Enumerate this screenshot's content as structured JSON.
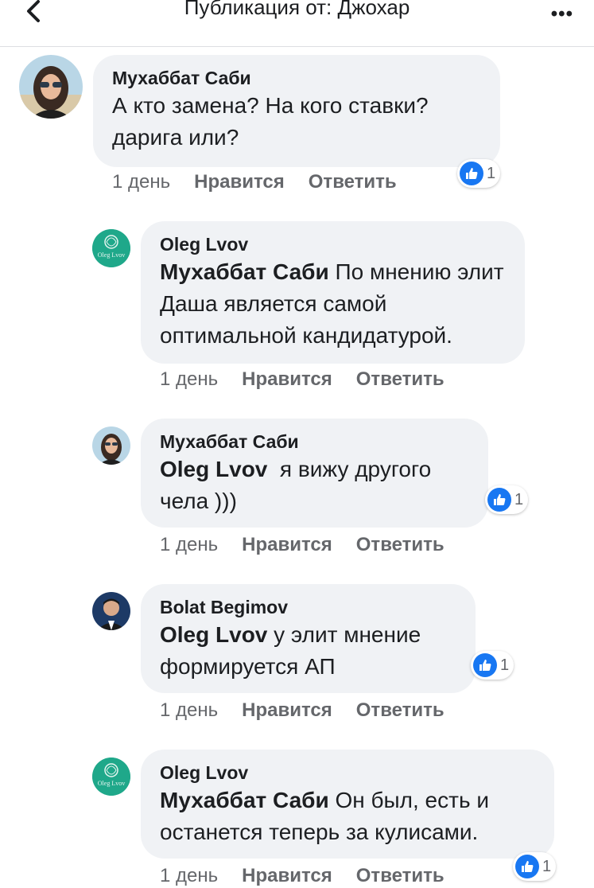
{
  "header": {
    "title": "Публикация от: Джохар",
    "more_label": "•••"
  },
  "comments": [
    {
      "author": "Мухаббат Саби",
      "mention": "",
      "text": "А кто замена? На кого ставки? дарига или?",
      "time": "1 день",
      "like_label": "Нравится",
      "reply_label": "Ответить",
      "reactions": "1"
    },
    {
      "author": "Oleg Lvov",
      "mention": "Мухаббат Саби",
      "text": "По мнению элит Даша является самой оптимальной кандидатурой.",
      "time": "1 день",
      "like_label": "Нравится",
      "reply_label": "Ответить",
      "avatar_text": "Oleg Lvov"
    },
    {
      "author": "Мухаббат Саби",
      "mention": "Oleg Lvov",
      "text": " я вижу другого чела )))",
      "time": "1 день",
      "like_label": "Нравится",
      "reply_label": "Ответить",
      "reactions": "1"
    },
    {
      "author": "Bolat Begimov",
      "mention": "Oleg Lvov",
      "text": "у элит мнение формируется АП",
      "time": "1 день",
      "like_label": "Нравится",
      "reply_label": "Ответить",
      "reactions": "1"
    },
    {
      "author": "Oleg Lvov",
      "mention": "Мухаббат Саби",
      "text": "Он был, есть и останется теперь за кулисами.",
      "time": "1 день",
      "like_label": "Нравится",
      "reply_label": "Ответить",
      "reactions": "1",
      "avatar_text": "Oleg Lvov"
    }
  ],
  "colors": {
    "like_blue": "#1877f2",
    "bubble_bg": "#f0f2f5",
    "meta_gray": "#65676b",
    "oleg_avatar": "#1fa88a"
  }
}
